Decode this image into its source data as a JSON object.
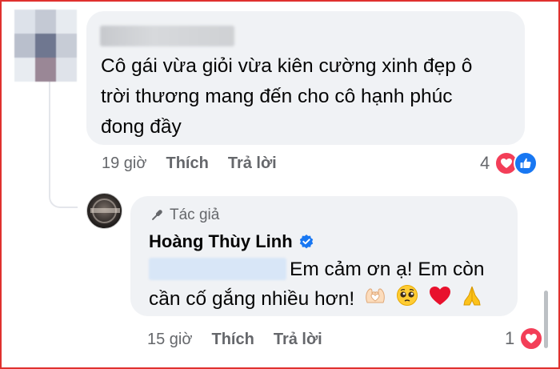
{
  "comment": {
    "text": "Cô gái vừa giỏi vừa kiên cường xinh đẹp ô\ntrời thương mang đến cho cô hạnh phúc\nđong đầy",
    "time": "19 giờ",
    "like_label": "Thích",
    "reply_label": "Trả lời",
    "reaction_count": "4",
    "reactions": [
      "heart-reaction",
      "like-reaction"
    ]
  },
  "reply": {
    "author_badge": "Tác giả",
    "author_name": "Hoàng Thùy Linh",
    "text": "Em cảm ơn ạ! Em còn cần cố gắng nhiều hơn!",
    "emojis": [
      "heart-hands",
      "pleading-face",
      "red-heart",
      "folded-hands"
    ],
    "time": "15 giờ",
    "like_label": "Thích",
    "reply_label": "Trả lời",
    "reaction_count": "1",
    "reactions": [
      "heart-reaction"
    ]
  },
  "colors": {
    "bubble": "#f0f2f5",
    "secondary_text": "#65676b",
    "heart": "#f33e58",
    "like": "#1877f2",
    "frame": "#e0312e"
  }
}
